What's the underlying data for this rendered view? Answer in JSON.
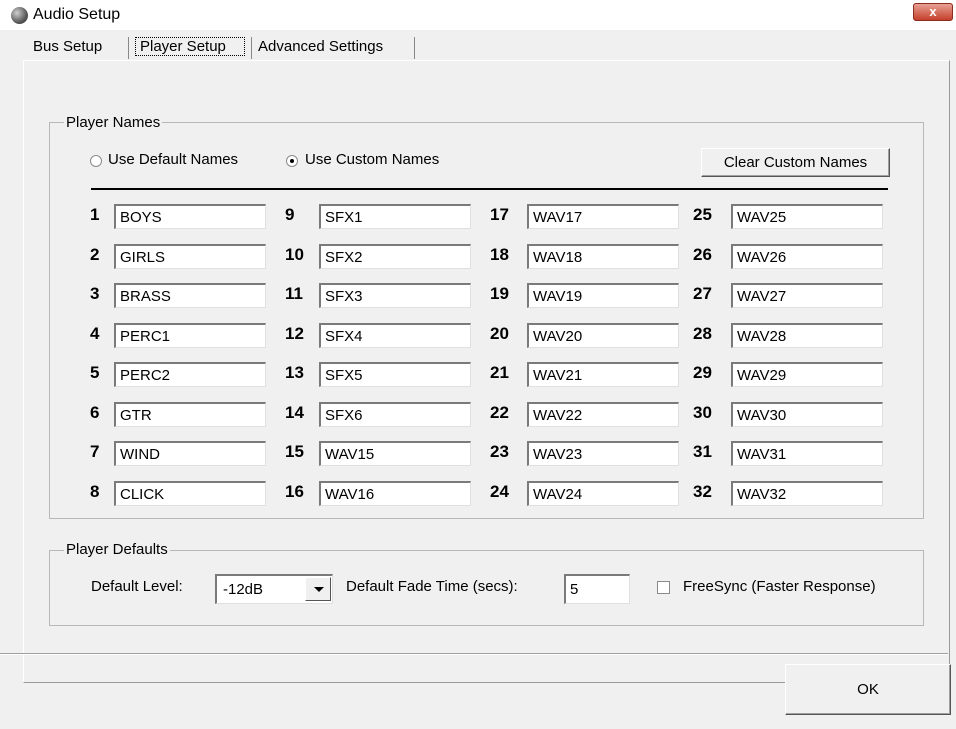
{
  "window": {
    "title": "Audio Setup",
    "close_glyph": "x"
  },
  "tabs": [
    {
      "label": "Bus Setup"
    },
    {
      "label": "Player Setup"
    },
    {
      "label": "Advanced Settings"
    }
  ],
  "player_names": {
    "group_label": "Player Names",
    "radio_default_label": "Use Default Names",
    "radio_custom_label": "Use Custom Names",
    "selected_option": "custom",
    "clear_button_label": "Clear Custom Names",
    "players": [
      {
        "num": "1",
        "name": "BOYS"
      },
      {
        "num": "2",
        "name": "GIRLS"
      },
      {
        "num": "3",
        "name": "BRASS"
      },
      {
        "num": "4",
        "name": "PERC1"
      },
      {
        "num": "5",
        "name": "PERC2"
      },
      {
        "num": "6",
        "name": "GTR"
      },
      {
        "num": "7",
        "name": "WIND"
      },
      {
        "num": "8",
        "name": "CLICK"
      },
      {
        "num": "9",
        "name": "SFX1"
      },
      {
        "num": "10",
        "name": "SFX2"
      },
      {
        "num": "11",
        "name": "SFX3"
      },
      {
        "num": "12",
        "name": "SFX4"
      },
      {
        "num": "13",
        "name": "SFX5"
      },
      {
        "num": "14",
        "name": "SFX6"
      },
      {
        "num": "15",
        "name": "WAV15"
      },
      {
        "num": "16",
        "name": "WAV16"
      },
      {
        "num": "17",
        "name": "WAV17"
      },
      {
        "num": "18",
        "name": "WAV18"
      },
      {
        "num": "19",
        "name": "WAV19"
      },
      {
        "num": "20",
        "name": "WAV20"
      },
      {
        "num": "21",
        "name": "WAV21"
      },
      {
        "num": "22",
        "name": "WAV22"
      },
      {
        "num": "23",
        "name": "WAV23"
      },
      {
        "num": "24",
        "name": "WAV24"
      },
      {
        "num": "25",
        "name": "WAV25"
      },
      {
        "num": "26",
        "name": "WAV26"
      },
      {
        "num": "27",
        "name": "WAV27"
      },
      {
        "num": "28",
        "name": "WAV28"
      },
      {
        "num": "29",
        "name": "WAV29"
      },
      {
        "num": "30",
        "name": "WAV30"
      },
      {
        "num": "31",
        "name": "WAV31"
      },
      {
        "num": "32",
        "name": "WAV32"
      }
    ]
  },
  "player_defaults": {
    "group_label": "Player Defaults",
    "level_label": "Default Level:",
    "level_value": "-12dB",
    "fade_label": "Default Fade Time (secs):",
    "fade_value": "5",
    "freesync_label": "FreeSync (Faster Response)",
    "freesync_checked": false
  },
  "footer": {
    "ok_label": "OK"
  }
}
